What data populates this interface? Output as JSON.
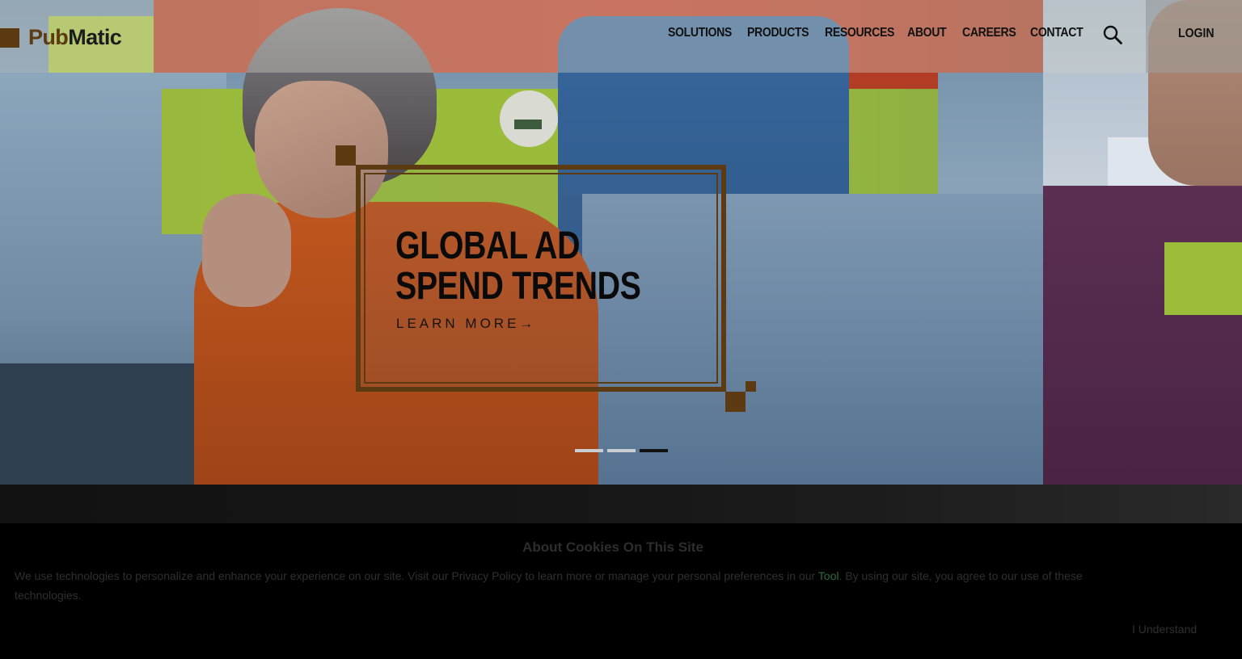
{
  "header": {
    "logo": {
      "part1": "Pub",
      "part2": "Matic"
    },
    "nav": [
      "SOLUTIONS",
      "PRODUCTS",
      "RESOURCES",
      "ABOUT",
      "CAREERS",
      "CONTACT"
    ],
    "search_icon": "search-icon",
    "login_label": "LOGIN"
  },
  "hero": {
    "title_line1": "GLOBAL AD",
    "title_line2": "SPEND TRENDS",
    "cta_label": "LEARN MORE",
    "cta_arrow": "→",
    "slider": {
      "total": 3,
      "active_index": 3
    }
  },
  "cookie": {
    "title": "About Cookies On This Site",
    "text_before": "We use technologies to personalize and enhance your experience on our site. Visit our Privacy Policy to learn more or manage your personal preferences in our ",
    "link_label": "Tool",
    "text_after": ". By using our site, you agree to our use of these technologies.",
    "button_label": "I Understand"
  },
  "colors": {
    "brand_brown": "#5c3b12",
    "text_dark": "#111111",
    "cookie_bg": "#000000",
    "cookie_link": "#2f6b3e"
  }
}
